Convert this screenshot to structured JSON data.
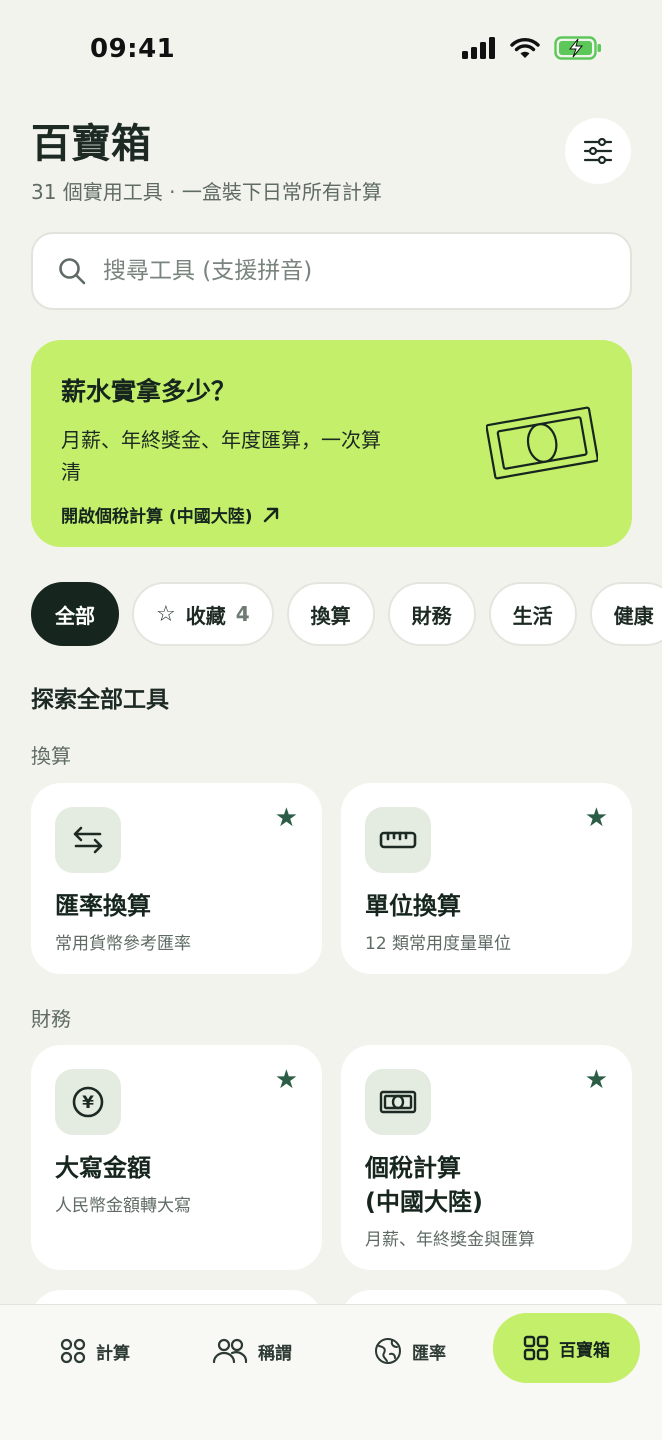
{
  "status_bar": {
    "time": "09:41"
  },
  "header": {
    "title": "百寶箱",
    "subtitle": "31 個實用工具 · 一盒裝下日常所有計算"
  },
  "search": {
    "placeholder": "搜尋工具 (支援拼音)"
  },
  "promo": {
    "title": "薪水實拿多少？",
    "description": "月薪、年終獎金、年度匯算，一次算清",
    "link_label": "開啟個稅計算 (中國大陸)"
  },
  "filter_chips": {
    "all": "全部",
    "favorites": "收藏",
    "favorites_count": "4",
    "convert": "換算",
    "finance": "財務",
    "life": "生活",
    "health": "健康"
  },
  "section_heading": "探索全部工具",
  "groups": {
    "convert": {
      "label": "換算",
      "cards": [
        {
          "title": "匯率換算",
          "desc": "常用貨幣參考匯率",
          "icon": "swap-arrows-icon",
          "favorited": true
        },
        {
          "title": "單位換算",
          "desc": "12 類常用度量單位",
          "icon": "ruler-icon",
          "favorited": true
        }
      ]
    },
    "finance": {
      "label": "財務",
      "cards": [
        {
          "title": "大寫金額",
          "desc": "人民幣金額轉大寫",
          "icon": "yen-coin-icon",
          "favorited": true
        },
        {
          "title": "個稅計算\n(中國大陸)",
          "desc": "月薪、年終獎金與匯算",
          "icon": "banknote-icon",
          "favorited": true
        }
      ]
    }
  },
  "tabbar": {
    "calc": "計算",
    "relation": "稱謂",
    "rate": "匯率",
    "toolbox": "百寶箱"
  },
  "colors": {
    "accent": "#c3ef6a",
    "dark": "#16261e",
    "background": "#f3f3ee",
    "star": "#2b5c45"
  }
}
